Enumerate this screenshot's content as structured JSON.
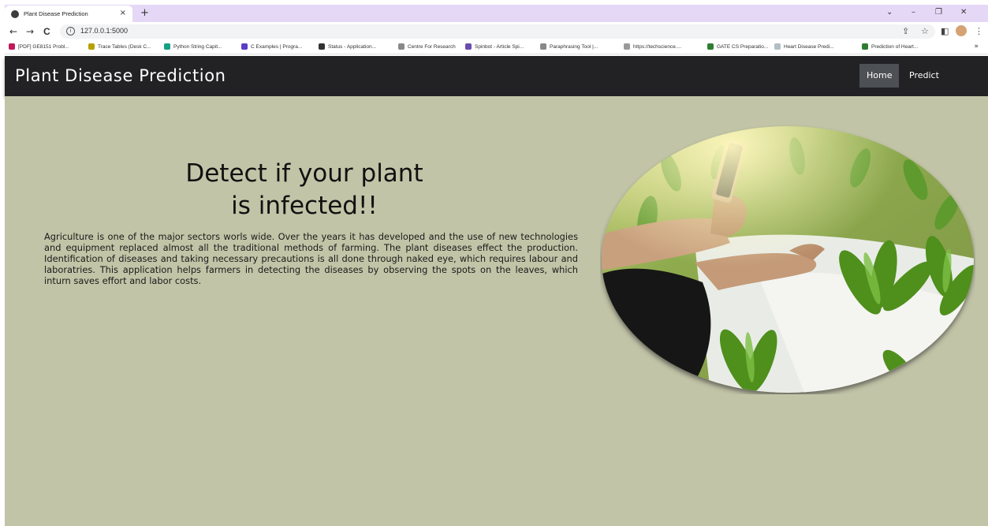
{
  "browser": {
    "tab_title": "Plant Disease Prediction",
    "tab_close": "×",
    "new_tab": "+",
    "url": "127.0.0.1:5000",
    "info_icon_glyph": "i",
    "nav": {
      "back": "←",
      "forward": "→",
      "reload": "C"
    },
    "window_controls": {
      "dropdown": "⌄",
      "minimize": "–",
      "restore": "❐",
      "close": "✕"
    },
    "toolbar": {
      "share": "⇪",
      "star": "☆",
      "sidebar": "◧",
      "menu": "⋮"
    },
    "bookmarks": [
      {
        "label": "[PDF] GE8151 Probl...",
        "color": "#c2185b"
      },
      {
        "label": "Trace Tables (Desk C...",
        "color": "#b8a000"
      },
      {
        "label": "Python String Capit...",
        "color": "#16a085"
      },
      {
        "label": "C Examples | Progra...",
        "color": "#5b3cc4"
      },
      {
        "label": "Status - Application...",
        "color": "#333333"
      },
      {
        "label": "Centre For Research",
        "color": "#888888"
      },
      {
        "label": "Spinbot - Article Spi...",
        "color": "#6a4caf"
      },
      {
        "label": "Paraphrasing Tool |...",
        "color": "#888888"
      },
      {
        "label": "https://techscience....",
        "color": "#999999"
      },
      {
        "label": "GATE CS Preparatio...",
        "color": "#2e7d32"
      },
      {
        "label": "Heart Disease Predi...",
        "color": "#b0bec5"
      },
      {
        "label": "Prediction of Heart...",
        "color": "#2e7d32"
      }
    ],
    "bookmarks_more": "»",
    "chrome_color": "#e5d8f7"
  },
  "navbar": {
    "brand": "Plant Disease Prediction",
    "links": [
      {
        "label": "Home",
        "active": true
      },
      {
        "label": "Predict",
        "active": false
      }
    ],
    "background": "#222225"
  },
  "hero": {
    "headline_line1": "Detect if your plant",
    "headline_line2": "is infected!!",
    "intro": "Agriculture is one of the major sectors worls wide. Over the years it has developed and the use of new technologies and equipment replaced almost all the traditional methods of farming. The plant diseases effect the production. Identification of diseases and taking necessary precautions is all done through naked eye, which requires labour and laboratries. This application helps farmers in detecting the diseases by observing the spots on the leaves, which inturn saves effort and labor costs.",
    "background": "#c2c4a7",
    "image_icon": "photo-of-hand-holding-phone-over-seedlings"
  }
}
